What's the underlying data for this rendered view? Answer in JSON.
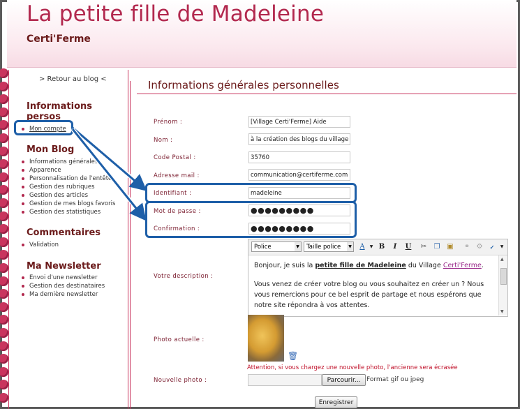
{
  "header": {
    "title": "La petite fille de Madeleine",
    "subtitle": "Certi'Ferme"
  },
  "sidebar": {
    "back_link": "> Retour au blog <",
    "sections": [
      {
        "title": "Informations persos",
        "items": [
          "Mon compte"
        ]
      },
      {
        "title": "Mon Blog",
        "items": [
          "Informations générales",
          "Apparence",
          "Personnalisation de l'entête",
          "Gestion des rubriques",
          "Gestion des articles",
          "Gestion de mes blogs favoris",
          "Gestion des statistiques"
        ]
      },
      {
        "title": "Commentaires",
        "items": [
          "Validation"
        ]
      },
      {
        "title": "Ma Newsletter",
        "items": [
          "Envoi d'une newsletter",
          "Gestion des destinataires",
          "Ma dernière newsletter"
        ]
      }
    ]
  },
  "main": {
    "title": "Informations générales personnelles",
    "fields": [
      {
        "label": "Prénom :",
        "value": "[Village Certi'Ferme] Aide"
      },
      {
        "label": "Nom :",
        "value": "à la création des blogs du village"
      },
      {
        "label": "Code Postal :",
        "value": "35760"
      },
      {
        "label": "Adresse mail :",
        "value": "communication@certiferme.com"
      },
      {
        "label": "Identifiant :",
        "value": "madeleine"
      },
      {
        "label": "Mot de passe :",
        "value": "●●●●●●●●●"
      },
      {
        "label": "Confirmation :",
        "value": "●●●●●●●●●"
      }
    ],
    "description_label": "Votre description :",
    "editor": {
      "font_select": "Police",
      "size_select": "Taille police",
      "para1_a": "Bonjour, je suis la ",
      "para1_b": "petite fille de Madeleine",
      "para1_c": " du Village ",
      "para1_d": "Certi'Ferme",
      "para1_e": ".",
      "para2": "Vous venez de créer votre blog ou vous souhaitez en créer un ? Nous vous remercions pour ce bel esprit de partage et nous espérons que notre site répondra à vos attentes."
    },
    "photo_label": "Photo actuelle :",
    "photo_warning": "Attention, si vous chargez une nouvelle photo, l'ancienne sera écrasée",
    "new_photo_label": "Nouvelle photo :",
    "browse_button": "Parcourir...",
    "format_note": "Format gif ou jpeg",
    "submit_button": "Enregistrer"
  },
  "colors": {
    "brand": "#b2284e",
    "dark_red": "#6b1b1b",
    "highlight": "#1e5fa8"
  }
}
